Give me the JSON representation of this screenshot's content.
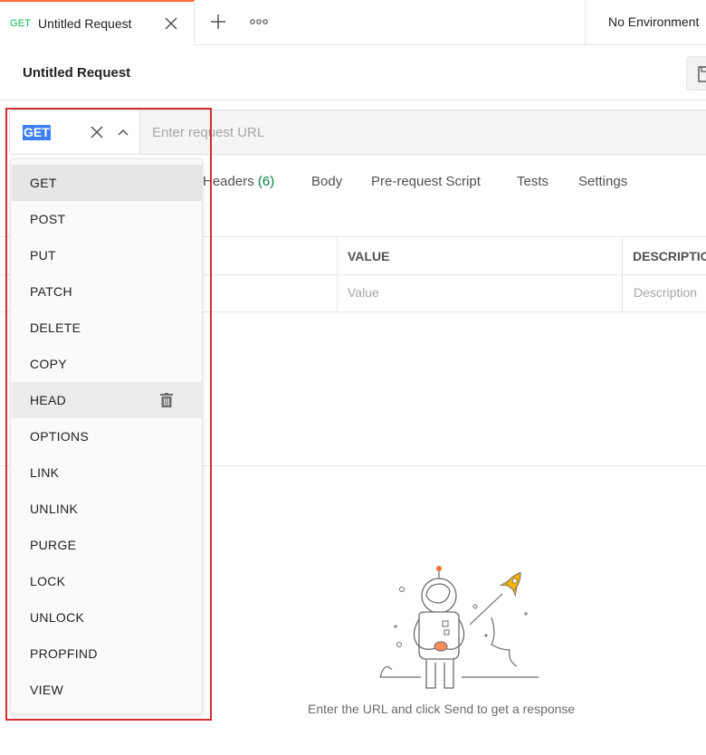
{
  "tabbar": {
    "tab": {
      "method": "GET",
      "title": "Untitled Request"
    },
    "environment": "No Environment"
  },
  "request": {
    "title": "Untitled Request",
    "method": "GET",
    "url_value": "",
    "url_placeholder": "Enter request URL"
  },
  "subtabs": {
    "headers": "Headers",
    "headers_count": "(6)",
    "body": "Body",
    "prerequest": "Pre-request Script",
    "tests": "Tests",
    "settings": "Settings"
  },
  "params_table": {
    "columns": [
      "VALUE",
      "DESCRIPTIO"
    ],
    "placeholders": [
      "Value",
      "Description"
    ]
  },
  "response": {
    "empty_message": "Enter the URL and click Send to get a response"
  },
  "method_dropdown": {
    "items": [
      "GET",
      "POST",
      "PUT",
      "PATCH",
      "DELETE",
      "COPY",
      "HEAD",
      "OPTIONS",
      "LINK",
      "UNLINK",
      "PURGE",
      "LOCK",
      "UNLOCK",
      "PROPFIND",
      "VIEW"
    ],
    "selected": "GET",
    "hovered": "HEAD"
  },
  "colors": {
    "accent": "#ff6c37",
    "get_method": "#0cbb52",
    "selection": "#3c7ff6",
    "annotation": "#d32f2f"
  },
  "icons": [
    "close-icon",
    "plus-icon",
    "more-icon",
    "save-icon",
    "clear-icon",
    "chevron-up-icon",
    "trash-icon"
  ]
}
